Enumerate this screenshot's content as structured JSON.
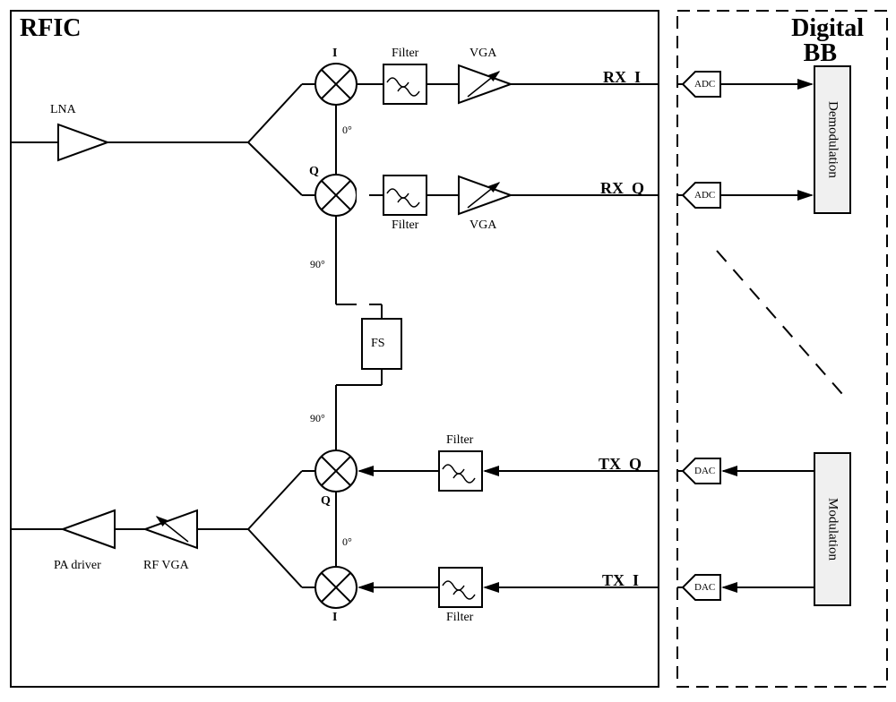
{
  "rfic": {
    "title": "RFIC"
  },
  "digital_bb": {
    "title_l1": "Digital",
    "title_l2": "BB",
    "demod": "Demodulation",
    "mod": "Modulation"
  },
  "rx": {
    "lna": "LNA",
    "i": {
      "mixer": "I",
      "phase": "0°",
      "filter": "Filter",
      "vga": "VGA",
      "signal": "RX_I",
      "adc": "ADC"
    },
    "q": {
      "mixer": "Q",
      "phase": "90°",
      "filter": "Filter",
      "vga": "VGA",
      "signal": "RX_Q",
      "adc": "ADC"
    }
  },
  "tx": {
    "pa_driver": "PA driver",
    "rf_vga": "RF VGA",
    "i": {
      "mixer": "I",
      "phase": "0°",
      "filter": "Filter",
      "signal": "TX_I",
      "dac": "DAC"
    },
    "q": {
      "mixer": "Q",
      "phase": "90°",
      "filter": "Filter",
      "signal": "TX_Q",
      "dac": "DAC"
    }
  },
  "fs": "FS"
}
